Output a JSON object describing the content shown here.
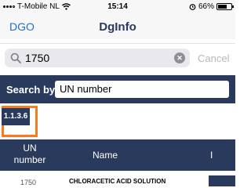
{
  "status_bar": {
    "carrier": "T-Mobile NL",
    "time": "15:14",
    "battery": "66%",
    "battery_level": 0.66,
    "icons": [
      "signal-dots-icon",
      "wifi-icon",
      "alarm-icon",
      "battery-icon"
    ]
  },
  "nav": {
    "back_label": "DGO",
    "title": "DgInfo"
  },
  "search": {
    "value": "1750",
    "cancel_label": "Cancel"
  },
  "search_by": {
    "label": "Search by",
    "selected": "UN number"
  },
  "tag": {
    "label": "1.1.3.6"
  },
  "table": {
    "columns": {
      "un": [
        "UN",
        "number"
      ],
      "name": "Name",
      "extra": "I"
    },
    "rows": [
      {
        "un": "1750",
        "name": "CHLORACETIC ACID SOLUTION"
      }
    ]
  },
  "colors": {
    "navy": "#2a3a5c",
    "link_blue": "#1f6fc5",
    "highlight_orange": "#f57c20"
  }
}
